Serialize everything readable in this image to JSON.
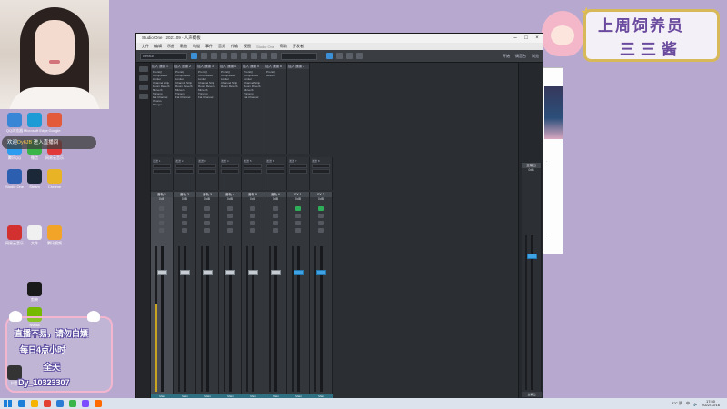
{
  "brand": {
    "line1": "上周饲养员",
    "line2": "三三酱"
  },
  "welcome": {
    "prefix": "欢迎",
    "user": "Dy6JB",
    "suffix": "进入直播间"
  },
  "info": {
    "line1": "直播不易，请勿白嫖",
    "line2": "每日4点小时",
    "line3": "全天",
    "line4": "Dy_10323307"
  },
  "desktop_icons": [
    {
      "label": "QQ浏览器",
      "color": "#3a86d6"
    },
    {
      "label": "Microsoft Edge",
      "color": "#1c9bd6"
    },
    {
      "label": "Google",
      "color": "#e25a3a"
    },
    {
      "label": "腾讯QQ",
      "color": "#2c9cf0"
    },
    {
      "label": "微信",
      "color": "#39b54a"
    },
    {
      "label": "网易云音乐",
      "color": "#e23a3a"
    },
    {
      "label": "Studio One",
      "color": "#2c5fb0"
    },
    {
      "label": "Steam",
      "color": "#1b2838"
    },
    {
      "label": "Chrome",
      "color": "#e8b324"
    },
    {
      "label": "网易云音乐",
      "color": "#d33030"
    },
    {
      "label": "文件",
      "color": "#f0f0f0"
    },
    {
      "label": "腾讯视频",
      "color": "#f2a428"
    },
    {
      "label": "Nvidia",
      "color": "#76b900"
    },
    {
      "label": "剪映",
      "color": "#1a1a1a"
    },
    {
      "label": "抖音",
      "color": "#111111"
    }
  ],
  "window": {
    "title": "Studio One - 2021.09 - 人声模板",
    "menu": [
      "文件",
      "编辑",
      "乐曲",
      "歌曲",
      "轨道",
      "事件",
      "音频",
      "传输",
      "视图",
      "Studio One",
      "帮助",
      "开发者"
    ],
    "menu_gray_index": 9,
    "toolbar_field": "Default",
    "toolbar_right": [
      "开始",
      "调音台",
      "浏览"
    ]
  },
  "rack": {
    "headers": [
      "插入 通道 1",
      "插入 通道 2",
      "插入 通道 3",
      "插入 通道 4",
      "插入 通道 5",
      "插入 通道 6",
      "插入 通道 7"
    ],
    "slots": [
      [
        "Pro EQ",
        "Compressor",
        "Limiter",
        "Channel Strip",
        "Room Reverb",
        "Mixverb",
        "Tricomp",
        "Fat Channel",
        "Chorus",
        "Flanger"
      ],
      [
        "Pro EQ",
        "Compressor",
        "Limiter",
        "Channel Strip",
        "Room Reverb",
        "Mixverb",
        "Tricomp",
        "Fat Channel"
      ],
      [
        "Pro EQ",
        "Compressor",
        "Limiter",
        "Channel Strip",
        "Room Reverb",
        "Mixverb",
        "Tricomp",
        "Fat Channel"
      ],
      [
        "Pro EQ",
        "Compressor",
        "Limiter",
        "Channel Strip",
        "Room Reverb"
      ],
      [
        "Pro EQ",
        "Compressor",
        "Limiter",
        "Channel Strip",
        "Room Reverb",
        "Mixverb",
        "Tricomp",
        "Fat Channel"
      ],
      [
        "Pro EQ",
        "Reverb"
      ],
      []
    ]
  },
  "sends": {
    "labels": [
      "发送 1",
      "发送 2",
      "发送 3",
      "发送 4",
      "发送 5",
      "发送 6",
      "发送 7",
      "发送 8"
    ]
  },
  "channels": [
    {
      "name": "音轨 1",
      "vol": "0dB",
      "fader_pct": 84,
      "meter_pct": 60,
      "foot": "Main",
      "selected": true
    },
    {
      "name": "音轨 2",
      "vol": "0dB",
      "fader_pct": 84,
      "meter_pct": 0,
      "foot": "Main",
      "selected": false
    },
    {
      "name": "音轨 3",
      "vol": "0dB",
      "fader_pct": 84,
      "meter_pct": 0,
      "foot": "Main",
      "selected": false
    },
    {
      "name": "音轨 4",
      "vol": "0dB",
      "fader_pct": 84,
      "meter_pct": 0,
      "foot": "Main",
      "selected": false
    },
    {
      "name": "音轨 5",
      "vol": "0dB",
      "fader_pct": 84,
      "meter_pct": 0,
      "foot": "Main",
      "selected": false
    },
    {
      "name": "音轨 6",
      "vol": "0dB",
      "fader_pct": 84,
      "meter_pct": 0,
      "foot": "Main",
      "selected": false
    },
    {
      "name": "FX 1",
      "vol": "0dB",
      "fader_pct": 84,
      "meter_pct": 0,
      "foot": "Main",
      "selected": false
    },
    {
      "name": "FX 2",
      "vol": "0dB",
      "fader_pct": 84,
      "meter_pct": 0,
      "foot": "Main",
      "selected": false
    }
  ],
  "master": {
    "name": "主输出",
    "vol": "0dB",
    "foot": "主输出"
  },
  "taskbar": {
    "icons": [
      "#1a7fd9",
      "#f4b400",
      "#e34133",
      "#2b7cd3",
      "#39b54a",
      "#7c4dff",
      "#ff6a00"
    ],
    "tray_weather": "4°C 阴",
    "tray_lang": "中",
    "time": "17:50",
    "date": "2022/12/16"
  }
}
